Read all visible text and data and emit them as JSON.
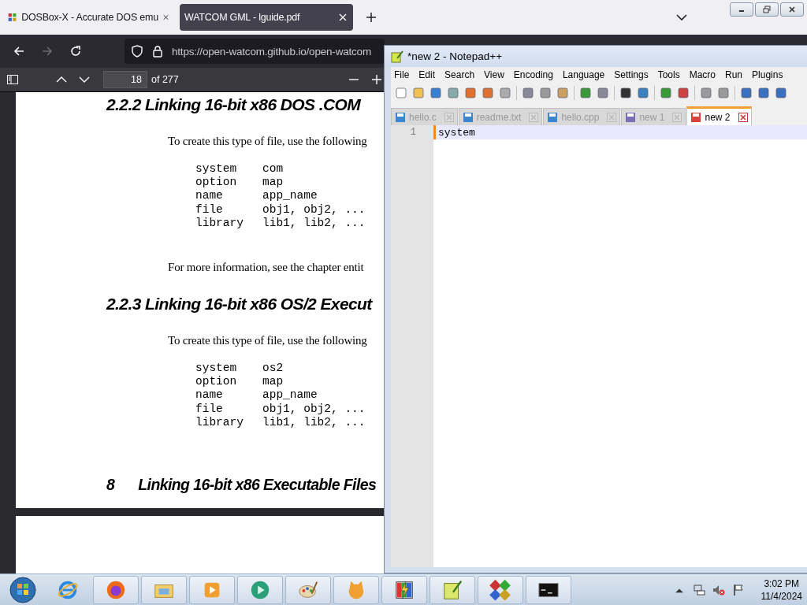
{
  "browser": {
    "tabs": [
      {
        "label": "DOSBox-X - Accurate DOS emu",
        "selected": false
      },
      {
        "label": "WATCOM GML - lguide.pdf",
        "selected": true
      }
    ],
    "url": "https://open-watcom.github.io/open-watcom",
    "pdf_toolbar": {
      "page": "18",
      "page_count": "of 277"
    },
    "pdf_page": {
      "blocks": [
        {
          "kind": "heading",
          "text": "2.2.2 Linking 16-bit x86 DOS .COM"
        },
        {
          "kind": "para",
          "text": "To create this type of file, use the following"
        },
        {
          "kind": "code",
          "lines": [
            [
              "system",
              "com"
            ],
            [
              "option",
              "map"
            ],
            [
              "name",
              "app_name"
            ],
            [
              "file",
              "obj1, obj2, ..."
            ],
            [
              "library",
              "lib1, lib2, ..."
            ]
          ]
        },
        {
          "kind": "para",
          "text": "For more information, see the chapter entit"
        },
        {
          "kind": "heading",
          "text": "2.2.3 Linking 16-bit x86 OS/2 Execut"
        },
        {
          "kind": "para",
          "text": "To create this type of file, use the following"
        },
        {
          "kind": "code",
          "lines": [
            [
              "system",
              "os2"
            ],
            [
              "option",
              "map"
            ],
            [
              "name",
              "app_name"
            ],
            [
              "file",
              "obj1, obj2, ..."
            ],
            [
              "library",
              "lib1, lib2, ..."
            ]
          ]
        }
      ],
      "footer": {
        "page_number": "8",
        "title": "Linking 16-bit x86 Executable Files"
      }
    }
  },
  "notepad": {
    "title": "*new 2 - Notepad++",
    "menu": [
      "File",
      "Edit",
      "Search",
      "View",
      "Encoding",
      "Language",
      "Settings",
      "Tools",
      "Macro",
      "Run",
      "Plugins"
    ],
    "tabs": [
      {
        "label": "hello.c",
        "selected": false,
        "color": "#3a86d0"
      },
      {
        "label": "readme.txt",
        "selected": false,
        "color": "#3a86d0"
      },
      {
        "label": "hello.cpp",
        "selected": false,
        "color": "#3a86d0"
      },
      {
        "label": "new 1",
        "selected": false,
        "color": "#7a70b8"
      },
      {
        "label": "new 2",
        "selected": true,
        "color": "#d9443a"
      }
    ],
    "editor": {
      "lines": [
        {
          "number": "1",
          "text": "system",
          "current": true
        }
      ]
    }
  },
  "taskbar": {
    "time": "3:02 PM",
    "date": "11/4/2024"
  }
}
